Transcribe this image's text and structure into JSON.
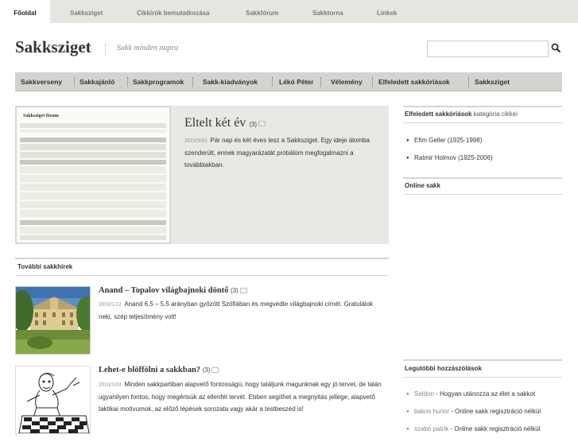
{
  "topnav": {
    "tabs": [
      {
        "label": "Főoldal"
      },
      {
        "label": "Sakksziget"
      },
      {
        "label": "Cikkírók bemutatkozása"
      },
      {
        "label": "Sakkfórum"
      },
      {
        "label": "Sakktorna"
      },
      {
        "label": "Linkek"
      }
    ]
  },
  "header": {
    "title": "Sakksziget",
    "slogan": "Sakk minden napra"
  },
  "search": {
    "placeholder": ""
  },
  "mainnav": {
    "items": [
      {
        "label": "Sakkverseny"
      },
      {
        "label": "Sakkajánló"
      },
      {
        "label": "Sakkprogramok"
      },
      {
        "label": "Sakk-kiadványok"
      },
      {
        "label": "Lékó Péter"
      },
      {
        "label": "Vélemény"
      },
      {
        "label": "Elfeledett sakkóriások"
      },
      {
        "label": "Sakksziget"
      }
    ]
  },
  "feature": {
    "title": "Eltelt két év",
    "comment_count": "(3)",
    "date": "2010/9/03",
    "body": "Pár nap és két éves lesz a Sakksziget. Egy ideje álomba szenderült, ennek magyarázatát próbálom megfogalmazni a továbbiakban.",
    "thumb_title": "Sakksziget fórum"
  },
  "more_news": {
    "heading": "További sakkhírek",
    "posts": [
      {
        "title": "Anand – Topalov világbajnoki döntő",
        "comment_count": "(3)",
        "date": "2010/5/12",
        "body": "Anand 6.5 – 5.5 arányban győzött Szófiában és megvédte világbajnoki címét. Gratulálok neki, szép teljesítmény volt!"
      },
      {
        "title": "Lehet-e blöffölni a sakkban?",
        "comment_count": "(3)",
        "date": "2010/3/03",
        "body": "Minden sakkpartiban alapvető fontosságú, hogy találjunk magunknak egy jó tervet, de talán ugyanilyen fontos, hogy megértsük az ellenfél tervét. Ebben segíthet a megnyitás jellege, alapvető taktikai motívumok, az előző lépések sorozata vagy akár a testbeszéd is!"
      }
    ]
  },
  "sidebar": {
    "cat_heading_bold": "Elfeledett sakkóriások",
    "cat_heading_rest": "kategória cikkei",
    "cat_items": [
      {
        "label": "Efim Geller (1925-1998)"
      },
      {
        "label": "Ratmir Holmov (1925-2006)"
      }
    ],
    "online_heading": "Online sakk",
    "comments_heading": "Legutóbbi hozzászólások",
    "comments": [
      {
        "author": "Seldon",
        "sep": " - ",
        "post": "Hogyan utánozza az élet a sakkot"
      },
      {
        "author": "bakos hunor",
        "sep": " - ",
        "post": "Online sakk regisztráció nélkül"
      },
      {
        "author": "szabó patrik",
        "sep": " - ",
        "post": "Online sakk regisztráció nélkül"
      }
    ]
  },
  "colors": {
    "topnav_bg": "#e6e6e1",
    "mainnav_bg": "#d3d3cf",
    "feature_bg": "#e8e8e4"
  }
}
